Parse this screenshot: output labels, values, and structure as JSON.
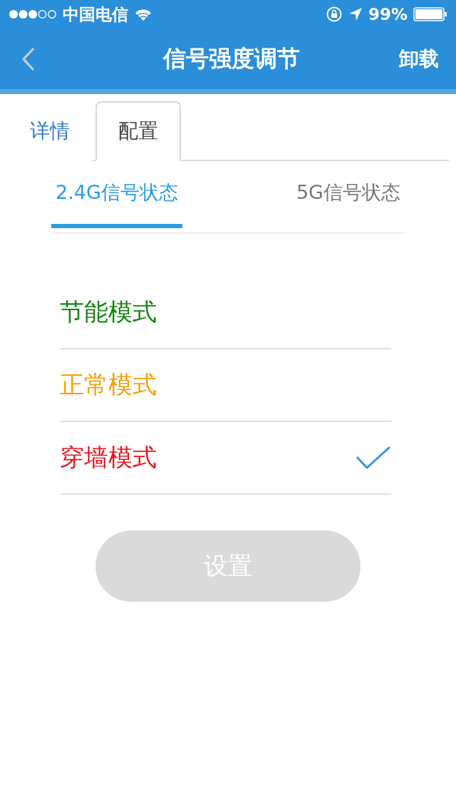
{
  "status_bar": {
    "carrier": "中国电信",
    "battery_text": "99%"
  },
  "nav": {
    "title": "信号强度调节",
    "action": "卸载"
  },
  "tabs": [
    {
      "label": "详情",
      "selected": false
    },
    {
      "label": "配置",
      "selected": true
    }
  ],
  "band_tabs": [
    {
      "label": "2.4G信号状态",
      "selected": true
    },
    {
      "label": "5G信号状态",
      "selected": false
    }
  ],
  "modes": [
    {
      "label": "节能模式",
      "color": "#128412",
      "selected": false
    },
    {
      "label": "正常模式",
      "color": "#f5a00a",
      "selected": false
    },
    {
      "label": "穿墙模式",
      "color": "#e8141c",
      "selected": true
    }
  ],
  "submit": {
    "label": "设置",
    "disabled": true
  }
}
